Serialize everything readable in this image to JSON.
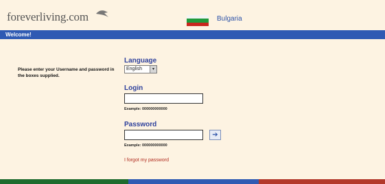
{
  "header": {
    "logo_text": "foreverliving.com",
    "country": "Bulgaria",
    "flag_colors": [
      "#f4f4f4",
      "#1f9a3c",
      "#c8261d"
    ]
  },
  "welcome_bar": {
    "label": "Welcome!"
  },
  "instructions": "Please enter your Username and password in the boxes supplied.",
  "form": {
    "language_label": "Language",
    "language_value": "English",
    "login_label": "Login",
    "login_value": "",
    "login_example": "Example: 000000000000",
    "password_label": "Password",
    "password_value": "",
    "password_example": "Example: 000000000000",
    "submit_icon": "arrow-right-icon",
    "forgot_link": "I forgot my password"
  },
  "footer": {
    "colors": [
      "#1e6b2e",
      "#2f5ab3",
      "#b3382a"
    ]
  }
}
